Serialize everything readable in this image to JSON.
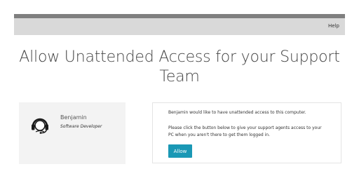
{
  "navbar": {
    "help_label": "Help"
  },
  "page": {
    "title": "Allow Unattended Access for your Support Team"
  },
  "agent": {
    "name": "Benjamin",
    "role": "Software Developer",
    "icon": "headset-icon"
  },
  "request": {
    "line1": "Benjamin would like to have unattended access to this computer.",
    "line2": "Please click the button below to give your support agents access to your PC when you aren't there to get them logged in.",
    "allow_label": "Allow"
  },
  "colors": {
    "topbar": "#7f7f7f",
    "navbar": "#d9d9d9",
    "accent": "#1a98b5",
    "card_bg": "#f3f3f3"
  }
}
